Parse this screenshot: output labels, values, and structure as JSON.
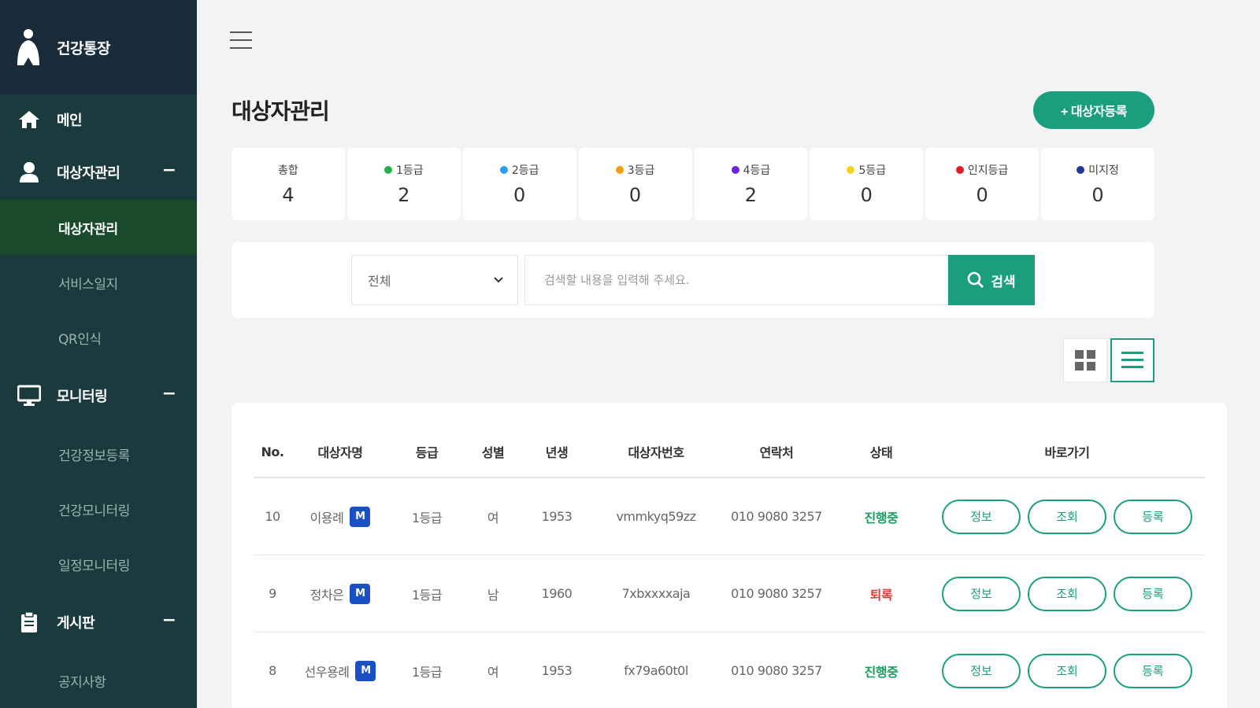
{
  "app": {
    "name": "건강통장"
  },
  "sidebar": {
    "main": "메인",
    "sections": [
      {
        "label": "대상자관리",
        "items": [
          "대상자관리",
          "서비스일지",
          "QR인식"
        ]
      },
      {
        "label": "모니터링",
        "items": [
          "건강정보등록",
          "건강모니터링",
          "일정모니터링"
        ]
      },
      {
        "label": "게시판",
        "items": [
          "공지사항"
        ]
      }
    ],
    "collapse_symbol": "−"
  },
  "page": {
    "title": "대상자관리",
    "add_button": "+ 대상자등록"
  },
  "stats": [
    {
      "label": "총합",
      "value": "4",
      "color": ""
    },
    {
      "label": "1등급",
      "value": "2",
      "color": "#22b14c"
    },
    {
      "label": "2등급",
      "value": "0",
      "color": "#2a9df4"
    },
    {
      "label": "3등급",
      "value": "0",
      "color": "#f39c12"
    },
    {
      "label": "4등급",
      "value": "2",
      "color": "#6a22e6"
    },
    {
      "label": "5등급",
      "value": "0",
      "color": "#f1d21b"
    },
    {
      "label": "인지등급",
      "value": "0",
      "color": "#e02020"
    },
    {
      "label": "미지정",
      "value": "0",
      "color": "#1b3a9c"
    }
  ],
  "search": {
    "select_value": "전체",
    "placeholder": "검색할 내용을 입력해 주세요.",
    "button": "검색"
  },
  "table": {
    "headers": [
      "No.",
      "대상자명",
      "등급",
      "성별",
      "년생",
      "대상자번호",
      "연락처",
      "상태",
      "바로가기"
    ],
    "badge": "M",
    "actions": [
      "정보",
      "조회",
      "등록"
    ],
    "rows": [
      {
        "no": "10",
        "name": "이용례",
        "grade": "1등급",
        "gender": "여",
        "year": "1953",
        "id": "vmmkyq59zz",
        "phone": "010 9080 3257",
        "status": "진행중",
        "status_type": "on"
      },
      {
        "no": "9",
        "name": "정차은",
        "grade": "1등급",
        "gender": "남",
        "year": "1960",
        "id": "7xbxxxxaja",
        "phone": "010 9080 3257",
        "status": "퇴록",
        "status_type": "off"
      },
      {
        "no": "8",
        "name": "선우용례",
        "grade": "1등급",
        "gender": "여",
        "year": "1953",
        "id": "fx79a60t0l",
        "phone": "010 9080 3257",
        "status": "진행중",
        "status_type": "on"
      }
    ]
  },
  "colors": {
    "accent": "#1a9e7e",
    "sidebar": "#1b3a3d",
    "brand_bg": "#1a2b3a",
    "active": "#1a4a2c"
  }
}
